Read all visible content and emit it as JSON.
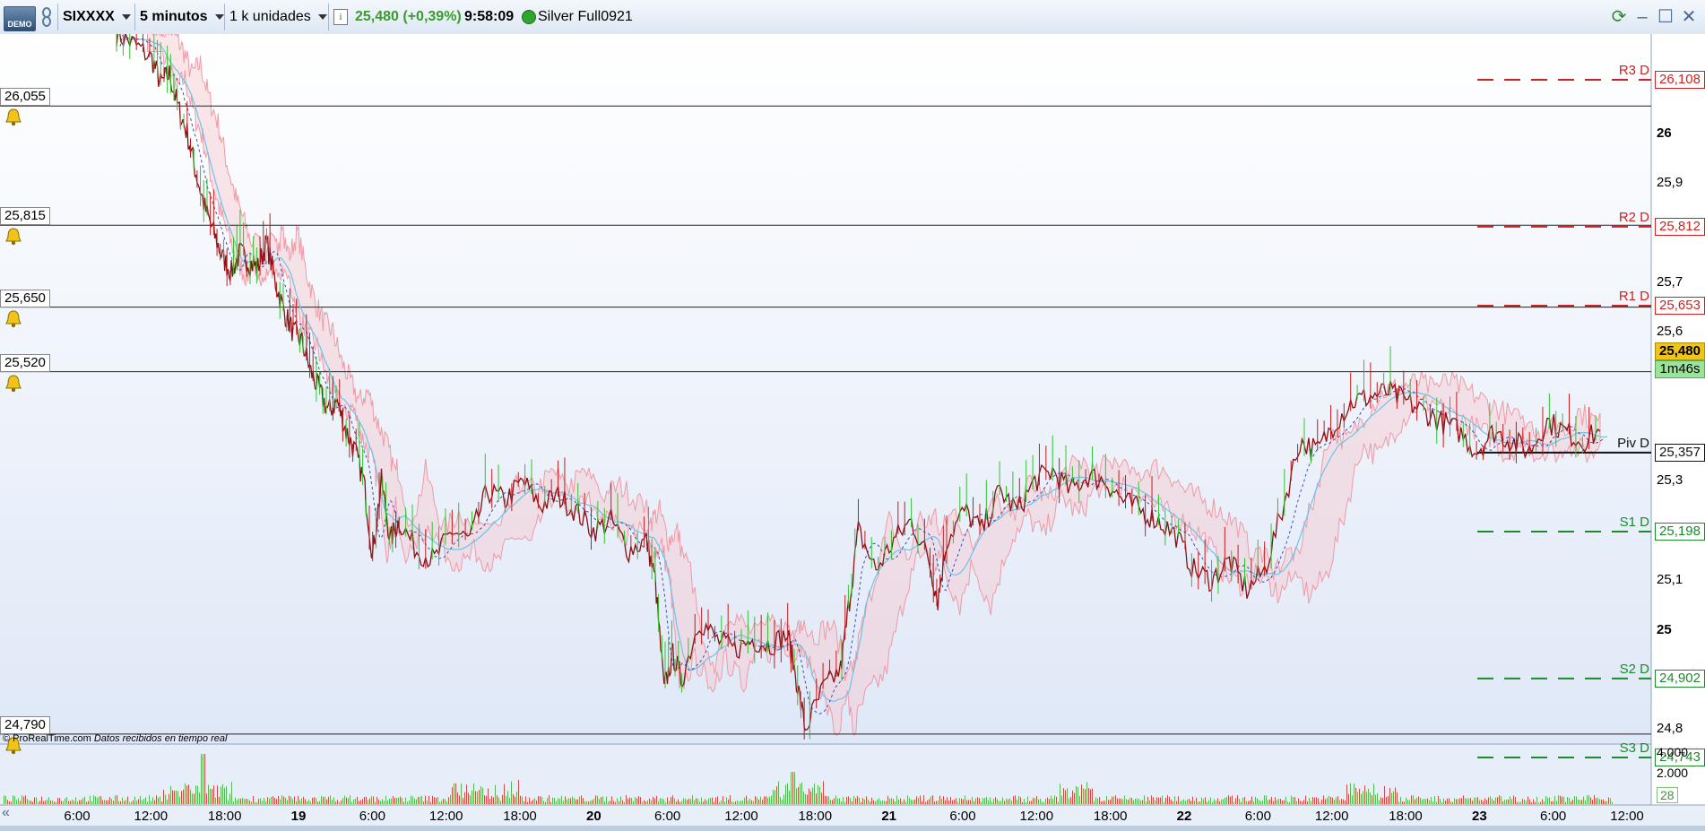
{
  "toolbar": {
    "demo_badge": "DEMO",
    "symbol": "SIXXXX",
    "timeframe": "5 minutos",
    "units": "1 k unidades",
    "price_change": "25,480 (+0,39%)",
    "time": "9:58:09",
    "instrument": "Silver Full0921"
  },
  "colors": {
    "price_up": "#3a9a2e",
    "resistance": "#d02020",
    "support": "#1a8a2a",
    "current_price_tag": "#f0c419",
    "countdown_tag": "#9be29b"
  },
  "alerts": [
    {
      "label": "26,055",
      "value": 26.055
    },
    {
      "label": "25,815",
      "value": 25.815
    },
    {
      "label": "25,650",
      "value": 25.65
    },
    {
      "label": "25,520",
      "value": 25.52
    },
    {
      "label": "24,790",
      "value": 24.79
    }
  ],
  "pivots": [
    {
      "name": "R3 D",
      "label": "26,108",
      "value": 26.108,
      "kind": "resistance"
    },
    {
      "name": "R2 D",
      "label": "25,812",
      "value": 25.812,
      "kind": "resistance"
    },
    {
      "name": "R1 D",
      "label": "25,653",
      "value": 25.653,
      "kind": "resistance"
    },
    {
      "name": "Piv D",
      "label": "25,357",
      "value": 25.357,
      "kind": "pivot"
    },
    {
      "name": "S1 D",
      "label": "25,198",
      "value": 25.198,
      "kind": "support"
    },
    {
      "name": "S2 D",
      "label": "24,902",
      "value": 24.902,
      "kind": "support"
    },
    {
      "name": "S3 D",
      "label": "24,743",
      "value": 24.743,
      "kind": "support"
    }
  ],
  "y_axis": {
    "ticks": [
      {
        "label": "26",
        "value": 26.0,
        "bold": true
      },
      {
        "label": "25,9",
        "value": 25.9
      },
      {
        "label": "25,7",
        "value": 25.7
      },
      {
        "label": "25,6",
        "value": 25.6
      },
      {
        "label": "25,3",
        "value": 25.3
      },
      {
        "label": "25,1",
        "value": 25.1
      },
      {
        "label": "25",
        "value": 25.0,
        "bold": true
      },
      {
        "label": "24,8",
        "value": 24.8
      }
    ],
    "range": [
      24.77,
      26.2
    ]
  },
  "current_price": {
    "label": "25,480",
    "value": 25.48
  },
  "countdown": "1m46s",
  "volume_axis": {
    "ticks": [
      "4.000",
      "2.000"
    ],
    "last": "28"
  },
  "x_axis": [
    {
      "label": "6:00"
    },
    {
      "label": "12:00"
    },
    {
      "label": "18:00"
    },
    {
      "label": "19",
      "bold": true
    },
    {
      "label": "6:00"
    },
    {
      "label": "12:00"
    },
    {
      "label": "18:00"
    },
    {
      "label": "20",
      "bold": true
    },
    {
      "label": "6:00"
    },
    {
      "label": "12:00"
    },
    {
      "label": "18:00"
    },
    {
      "label": "21",
      "bold": true
    },
    {
      "label": "6:00"
    },
    {
      "label": "12:00"
    },
    {
      "label": "18:00"
    },
    {
      "label": "22",
      "bold": true
    },
    {
      "label": "6:00"
    },
    {
      "label": "12:00"
    },
    {
      "label": "18:00"
    },
    {
      "label": "23",
      "bold": true
    },
    {
      "label": "6:00"
    },
    {
      "label": "12:00"
    }
  ],
  "footer": {
    "brand": "© ProRealTime.com",
    "note": "Datos recibidos en tiempo real"
  },
  "price_path": [
    [
      0,
      26.2
    ],
    [
      0.01,
      26.18
    ],
    [
      0.02,
      26.15
    ],
    [
      0.025,
      26.1
    ],
    [
      0.03,
      26.12
    ],
    [
      0.035,
      26.05
    ],
    [
      0.04,
      26.0
    ],
    [
      0.045,
      25.92
    ],
    [
      0.05,
      25.85
    ],
    [
      0.055,
      25.8
    ],
    [
      0.06,
      25.75
    ],
    [
      0.065,
      25.72
    ],
    [
      0.07,
      25.76
    ],
    [
      0.075,
      25.74
    ],
    [
      0.08,
      25.73
    ],
    [
      0.085,
      25.78
    ],
    [
      0.09,
      25.7
    ],
    [
      0.095,
      25.64
    ],
    [
      0.1,
      25.6
    ],
    [
      0.105,
      25.58
    ],
    [
      0.11,
      25.52
    ],
    [
      0.115,
      25.48
    ],
    [
      0.12,
      25.44
    ],
    [
      0.125,
      25.46
    ],
    [
      0.13,
      25.4
    ],
    [
      0.135,
      25.36
    ],
    [
      0.14,
      25.3
    ],
    [
      0.145,
      25.15
    ],
    [
      0.15,
      25.3
    ],
    [
      0.155,
      25.18
    ],
    [
      0.16,
      25.22
    ],
    [
      0.17,
      25.16
    ],
    [
      0.18,
      25.14
    ],
    [
      0.19,
      25.2
    ],
    [
      0.2,
      25.18
    ],
    [
      0.21,
      25.28
    ],
    [
      0.22,
      25.26
    ],
    [
      0.23,
      25.3
    ],
    [
      0.24,
      25.25
    ],
    [
      0.25,
      25.27
    ],
    [
      0.26,
      25.24
    ],
    [
      0.27,
      25.2
    ],
    [
      0.28,
      25.22
    ],
    [
      0.29,
      25.16
    ],
    [
      0.3,
      25.18
    ],
    [
      0.305,
      25.1
    ],
    [
      0.31,
      24.88
    ],
    [
      0.315,
      24.95
    ],
    [
      0.32,
      24.9
    ],
    [
      0.33,
      25.02
    ],
    [
      0.34,
      24.98
    ],
    [
      0.35,
      24.96
    ],
    [
      0.36,
      24.98
    ],
    [
      0.37,
      24.97
    ],
    [
      0.38,
      24.99
    ],
    [
      0.385,
      24.9
    ],
    [
      0.39,
      24.8
    ],
    [
      0.4,
      24.88
    ],
    [
      0.41,
      24.92
    ],
    [
      0.415,
      25.06
    ],
    [
      0.42,
      25.2
    ],
    [
      0.43,
      25.12
    ],
    [
      0.44,
      25.18
    ],
    [
      0.45,
      25.22
    ],
    [
      0.46,
      25.14
    ],
    [
      0.465,
      25.06
    ],
    [
      0.47,
      25.18
    ],
    [
      0.48,
      25.24
    ],
    [
      0.49,
      25.2
    ],
    [
      0.5,
      25.28
    ],
    [
      0.51,
      25.24
    ],
    [
      0.52,
      25.3
    ],
    [
      0.53,
      25.32
    ],
    [
      0.54,
      25.28
    ],
    [
      0.55,
      25.31
    ],
    [
      0.56,
      25.3
    ],
    [
      0.57,
      25.26
    ],
    [
      0.58,
      25.24
    ],
    [
      0.59,
      25.22
    ],
    [
      0.6,
      25.19
    ],
    [
      0.61,
      25.12
    ],
    [
      0.62,
      25.1
    ],
    [
      0.63,
      25.14
    ],
    [
      0.64,
      25.08
    ],
    [
      0.65,
      25.12
    ],
    [
      0.66,
      25.24
    ],
    [
      0.67,
      25.38
    ],
    [
      0.68,
      25.36
    ],
    [
      0.69,
      25.42
    ],
    [
      0.7,
      25.46
    ],
    [
      0.71,
      25.47
    ],
    [
      0.72,
      25.48
    ],
    [
      0.73,
      25.46
    ],
    [
      0.74,
      25.44
    ],
    [
      0.75,
      25.42
    ],
    [
      0.76,
      25.4
    ],
    [
      0.77,
      25.36
    ],
    [
      0.78,
      25.4
    ],
    [
      0.79,
      25.38
    ],
    [
      0.8,
      25.36
    ],
    [
      0.81,
      25.42
    ],
    [
      0.82,
      25.4
    ],
    [
      0.83,
      25.38
    ],
    [
      0.84,
      25.4
    ]
  ]
}
